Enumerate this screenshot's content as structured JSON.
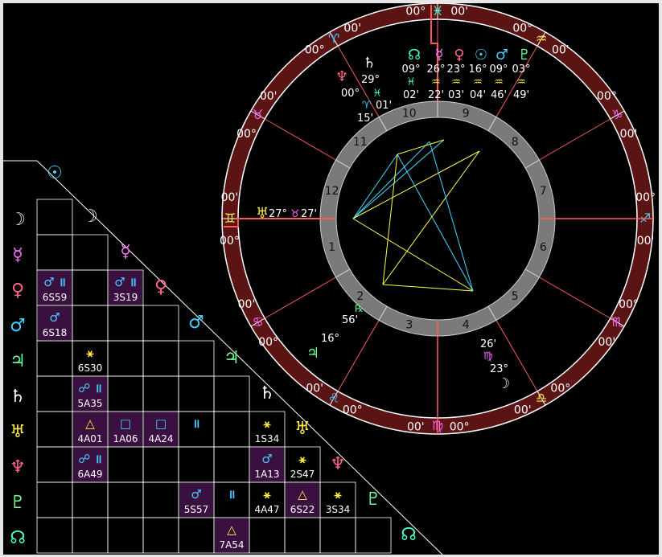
{
  "colors": {
    "background": "#000000",
    "ring": "#5a1414",
    "house_ring": "#7a7a7a",
    "house_line": "#ff5a5a",
    "aspect_yellow": "#ffff44",
    "aspect_cyan": "#44d8ff",
    "aspect_cell": "#3a1040",
    "fire": "#ff6677",
    "earth": "#ffd060",
    "air": "#ffff66",
    "water": "#44ffcc"
  },
  "signs": [
    {
      "glyph": "♓",
      "pos": "00°",
      "pos2": "00'",
      "color": "#44ffcc",
      "icon": "pisces-icon"
    },
    {
      "glyph": "♒",
      "pos": "00°",
      "pos2": "00'",
      "color": "#ffee44",
      "icon": "aquarius-icon"
    },
    {
      "glyph": "♑",
      "pos": "00°",
      "pos2": "00'",
      "color": "#ff66ff",
      "icon": "capricorn-icon"
    },
    {
      "glyph": "♐",
      "pos": "00°",
      "pos2": "00'",
      "color": "#44ccff",
      "icon": "sagittarius-icon"
    },
    {
      "glyph": "♏",
      "pos": "00°",
      "pos2": "00'",
      "color": "#ff66ff",
      "icon": "scorpio-icon"
    },
    {
      "glyph": "♎",
      "pos": "00°",
      "pos2": "00'",
      "color": "#ffee44",
      "icon": "libra-icon"
    },
    {
      "glyph": "♍",
      "pos": "00°",
      "pos2": "00'",
      "color": "#ff66ff",
      "icon": "virgo-icon"
    },
    {
      "glyph": "♌",
      "pos": "00°",
      "pos2": "00'",
      "color": "#44ccff",
      "icon": "leo-icon"
    },
    {
      "glyph": "♋",
      "pos": "00°",
      "pos2": "00'",
      "color": "#ff66ff",
      "icon": "cancer-icon"
    },
    {
      "glyph": "♊",
      "pos": "00°",
      "pos2": "00'",
      "color": "#ffee44",
      "icon": "gemini-icon"
    },
    {
      "glyph": "♉",
      "pos": "00°",
      "pos2": "00'",
      "color": "#ff66ff",
      "icon": "taurus-icon"
    },
    {
      "glyph": "♈",
      "pos": "00°",
      "pos2": "00'",
      "color": "#44ccff",
      "icon": "aries-icon"
    }
  ],
  "houses": [
    "1",
    "2",
    "3",
    "4",
    "5",
    "6",
    "7",
    "8",
    "9",
    "10",
    "11",
    "12"
  ],
  "top_planets": [
    {
      "glyph": "☊",
      "deg": "09°",
      "sign": "♓",
      "min": "02'",
      "color": "#44ffcc",
      "icon": "north-node-icon"
    },
    {
      "glyph": "☿",
      "deg": "26°",
      "sign": "♒",
      "min": "22'",
      "color": "#ff77ff",
      "icon": "mercury-icon"
    },
    {
      "glyph": "♀",
      "deg": "23°",
      "sign": "♒",
      "min": "03'",
      "color": "#ff6688",
      "icon": "venus-icon"
    },
    {
      "glyph": "☉",
      "deg": "16°",
      "sign": "♒",
      "min": "04'",
      "color": "#44ddff",
      "icon": "sun-icon"
    },
    {
      "glyph": "♂",
      "deg": "09°",
      "sign": "♒",
      "min": "46'",
      "color": "#44ccff",
      "icon": "mars-icon"
    },
    {
      "glyph": "♇",
      "deg": "03°",
      "sign": "♒",
      "min": "49'",
      "color": "#66ff99",
      "icon": "pluto-icon"
    }
  ],
  "saturn": {
    "glyph": "♄",
    "deg": "29°",
    "sign": "♓",
    "min": "01'",
    "icon": "saturn-icon"
  },
  "neptune": {
    "glyph": "♆",
    "deg": "00°",
    "sign": "♈",
    "min": "15'",
    "icon": "neptune-icon"
  },
  "uranus": {
    "glyph": "♅",
    "deg": "27°",
    "sign": "♉",
    "min": "27'",
    "icon": "uranus-icon"
  },
  "jupiter": {
    "glyph": "♃",
    "deg": "16°",
    "min": "56'",
    "retro": "℞",
    "icon": "jupiter-icon"
  },
  "moon": {
    "glyph": "☽",
    "deg": "23°",
    "sign": "♍",
    "min": "26'",
    "icon": "moon-icon"
  },
  "grid": {
    "planets": [
      {
        "glyph": "☉",
        "color": "#44ddff",
        "name": "sun"
      },
      {
        "glyph": "☽",
        "color": "#e8e8e8",
        "name": "moon"
      },
      {
        "glyph": "☿",
        "color": "#ff77ff",
        "name": "mercury"
      },
      {
        "glyph": "♀",
        "color": "#ff6688",
        "name": "venus"
      },
      {
        "glyph": "♂",
        "color": "#44ccff",
        "name": "mars"
      },
      {
        "glyph": "♃",
        "color": "#66ff99",
        "name": "jupiter"
      },
      {
        "glyph": "♄",
        "color": "#ffffff",
        "name": "saturn"
      },
      {
        "glyph": "♅",
        "color": "#ffee44",
        "name": "uranus"
      },
      {
        "glyph": "♆",
        "color": "#ff6688",
        "name": "neptune"
      },
      {
        "glyph": "♇",
        "color": "#66ff99",
        "name": "pluto"
      },
      {
        "glyph": "☊",
        "color": "#44ffcc",
        "name": "north-node"
      }
    ],
    "aspects": [
      {
        "row": 3,
        "col": 0,
        "sym": "♂ ॥",
        "label": "6S59",
        "bg": true
      },
      {
        "row": 3,
        "col": 2,
        "sym": "♂ ॥",
        "label": "3S19",
        "bg": true
      },
      {
        "row": 4,
        "col": 0,
        "sym": "♂",
        "label": "6S18",
        "bg": true
      },
      {
        "row": 5,
        "col": 1,
        "sym": "⚹",
        "label": "6S30",
        "bg": false
      },
      {
        "row": 6,
        "col": 1,
        "sym": "☍ ॥",
        "label": "5A35",
        "bg": true
      },
      {
        "row": 7,
        "col": 1,
        "sym": "△",
        "label": "4A01",
        "bg": true
      },
      {
        "row": 7,
        "col": 2,
        "sym": "□",
        "label": "1A06",
        "bg": true
      },
      {
        "row": 7,
        "col": 3,
        "sym": "□",
        "label": "4A24",
        "bg": true
      },
      {
        "row": 7,
        "col": 4,
        "sym": "॥",
        "label": "",
        "bg": false
      },
      {
        "row": 7,
        "col": 6,
        "sym": "⚹",
        "label": "1S34",
        "bg": false
      },
      {
        "row": 8,
        "col": 1,
        "sym": "☍ ॥",
        "label": "6A49",
        "bg": true
      },
      {
        "row": 8,
        "col": 6,
        "sym": "♂",
        "label": "1A13",
        "bg": true
      },
      {
        "row": 8,
        "col": 7,
        "sym": "⚹",
        "label": "2S47",
        "bg": false
      },
      {
        "row": 9,
        "col": 4,
        "sym": "♂",
        "label": "5S57",
        "bg": true
      },
      {
        "row": 9,
        "col": 5,
        "sym": "॥",
        "label": "",
        "bg": false
      },
      {
        "row": 9,
        "col": 6,
        "sym": "⚹",
        "label": "4A47",
        "bg": false
      },
      {
        "row": 9,
        "col": 7,
        "sym": "△",
        "label": "6S22",
        "bg": true
      },
      {
        "row": 9,
        "col": 8,
        "sym": "⚹",
        "label": "3S34",
        "bg": false
      },
      {
        "row": 10,
        "col": 5,
        "sym": "△",
        "label": "7A54",
        "bg": true
      }
    ]
  }
}
